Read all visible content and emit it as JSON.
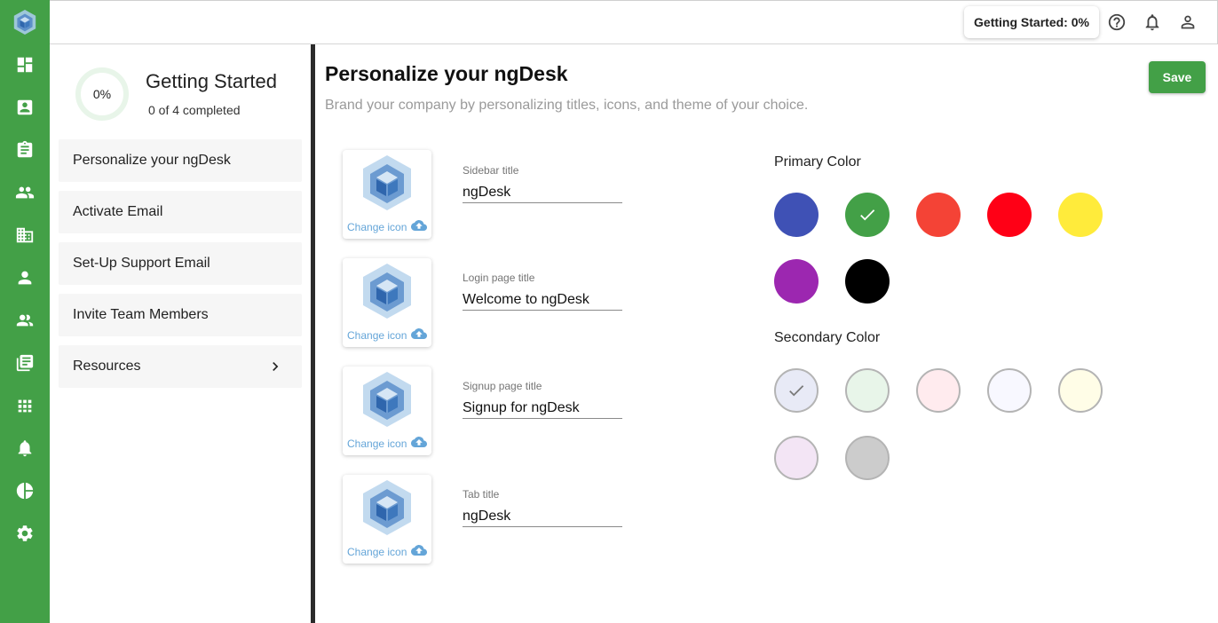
{
  "topbar": {
    "getting_started_chip": "Getting Started: 0%"
  },
  "getting_started": {
    "progress_percent": 0,
    "progress_label": "0%",
    "title": "Getting Started",
    "subtitle": "0 of 4 completed",
    "items": [
      {
        "label": "Personalize your ngDesk"
      },
      {
        "label": "Activate Email"
      },
      {
        "label": "Set-Up Support Email"
      },
      {
        "label": "Invite Team Members"
      },
      {
        "label": "Resources"
      }
    ]
  },
  "main": {
    "title": "Personalize your ngDesk",
    "subtitle": "Brand your company by personalizing titles, icons, and theme of your choice.",
    "save_label": "Save",
    "change_icon_label": "Change icon",
    "fields": [
      {
        "label": "Sidebar title",
        "value": "ngDesk"
      },
      {
        "label": "Login page title",
        "value": "Welcome to ngDesk"
      },
      {
        "label": "Signup page title",
        "value": "Signup for ngDesk"
      },
      {
        "label": "Tab title",
        "value": "ngDesk"
      }
    ],
    "primary_color_label": "Primary Color",
    "secondary_color_label": "Secondary Color",
    "primary_colors": [
      "#3f51b5",
      "#43a047",
      "#f44336",
      "#ff0016",
      "#ffeb3b",
      "#9c27b0",
      "#000000"
    ],
    "primary_selected": 1,
    "secondary_colors": [
      "#e8eaf6",
      "#e8f5e9",
      "#ffebee",
      "#f8f8ff",
      "#fffde7",
      "#f3e5f5",
      "#cccccc"
    ],
    "secondary_selected": 0
  },
  "colors": {
    "brand_green": "#43a047",
    "link_blue": "#64a5d8"
  }
}
